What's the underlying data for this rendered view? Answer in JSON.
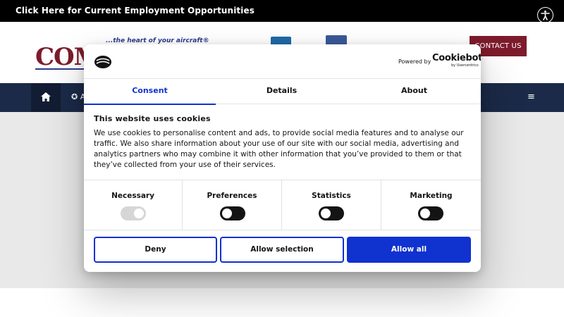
{
  "topbar": {
    "employment_link": "Click Here for Current Employment Opportunities",
    "accessibility_icon": "accessibility-icon"
  },
  "header": {
    "logo_text": "COM",
    "tagline": "...the heart of your aircraft®",
    "contact_label": "CONTACT US",
    "social": [
      "linkedin-icon",
      "facebook-icon"
    ],
    "colors": {
      "brand": "#7d1b2c",
      "navy": "#1b2a48",
      "accent_blue": "#2b3c8e"
    }
  },
  "nav": {
    "home_icon": "home-icon",
    "item_label": "✪ A",
    "menu_icon": "hamburger-icon"
  },
  "cookie_dialog": {
    "powered_by": "Powered by",
    "brand": "Cookiebot",
    "brand_sub": "by Usercentrics",
    "tabs": [
      {
        "label": "Consent",
        "active": true
      },
      {
        "label": "Details",
        "active": false
      },
      {
        "label": "About",
        "active": false
      }
    ],
    "heading": "This website uses cookies",
    "description": "We use cookies to personalise content and ads, to provide social media features and to analyse our traffic. We also share information about your use of our site with our social media, advertising and analytics partners who may combine it with other information that you’ve provided to them or that they’ve collected from your use of their services.",
    "categories": [
      {
        "label": "Necessary",
        "enabled": true,
        "disabled": true
      },
      {
        "label": "Preferences",
        "enabled": false,
        "disabled": false
      },
      {
        "label": "Statistics",
        "enabled": false,
        "disabled": false
      },
      {
        "label": "Marketing",
        "enabled": false,
        "disabled": false
      }
    ],
    "buttons": {
      "deny": "Deny",
      "allow_selection": "Allow selection",
      "allow_all": "Allow all"
    },
    "colors": {
      "primary": "#1032cf",
      "text": "#141414"
    }
  }
}
